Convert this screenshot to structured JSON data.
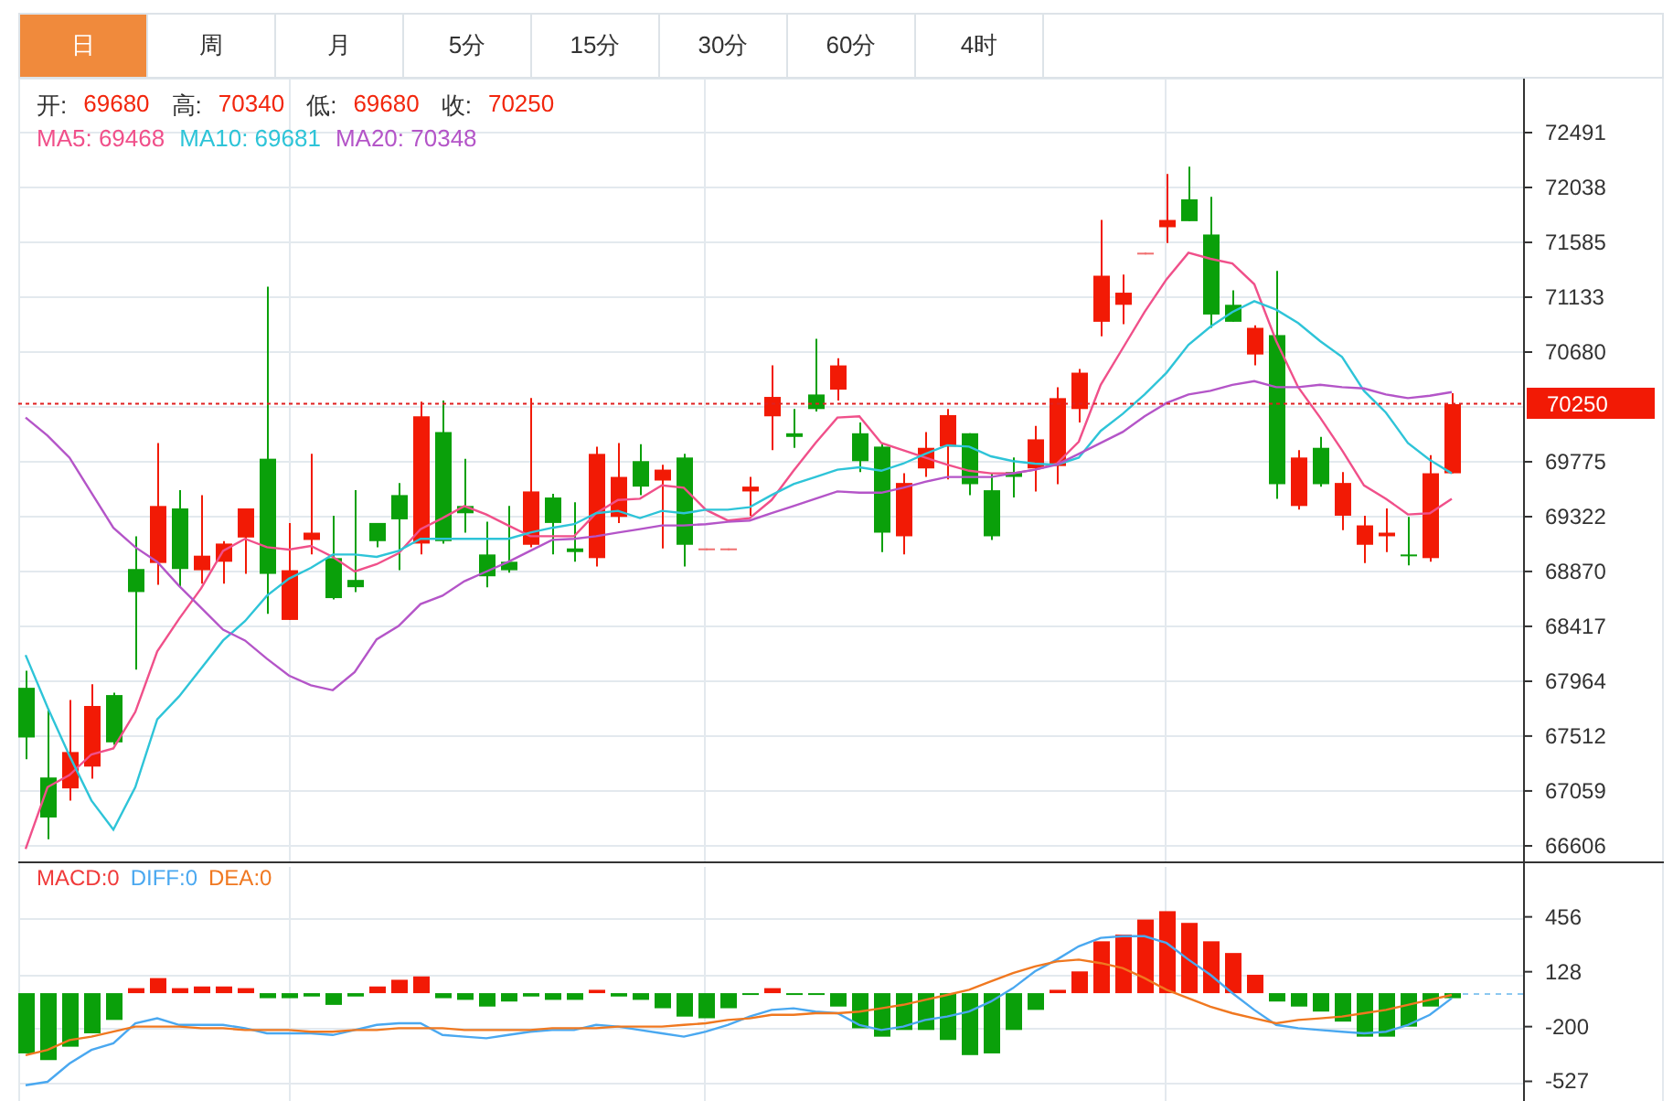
{
  "tabs": [
    {
      "label": "日",
      "selected": true
    },
    {
      "label": "周",
      "selected": false
    },
    {
      "label": "月",
      "selected": false
    },
    {
      "label": "5分",
      "selected": false
    },
    {
      "label": "15分",
      "selected": false
    },
    {
      "label": "30分",
      "selected": false
    },
    {
      "label": "60分",
      "selected": false
    },
    {
      "label": "4时",
      "selected": false
    }
  ],
  "price_chart": {
    "ohlc_legend": [
      {
        "label": "开:",
        "value": "69680"
      },
      {
        "label": "高:",
        "value": "70340"
      },
      {
        "label": "低:",
        "value": "69680"
      },
      {
        "label": "收:",
        "value": "70250"
      }
    ],
    "ma_legend": [
      {
        "text": "MA5: 69468",
        "color": "#f0508a"
      },
      {
        "text": "MA10: 69681",
        "color": "#2ec4d8"
      },
      {
        "text": "MA20: 70348",
        "color": "#b455c8"
      }
    ],
    "chart_data": {
      "type": "candlestick",
      "ylim": [
        66470,
        72936
      ],
      "yticks": [
        72491,
        72038,
        71585,
        71133,
        70680,
        69775,
        69322,
        68870,
        68417,
        67964,
        67512,
        67059,
        66606
      ],
      "ohlc": [
        [
          67910,
          68050,
          67320,
          67500
        ],
        [
          67170,
          67730,
          66660,
          66840
        ],
        [
          67080,
          67810,
          66980,
          67380
        ],
        [
          67260,
          67940,
          67160,
          67760
        ],
        [
          67850,
          67870,
          67440,
          67460
        ],
        [
          68890,
          69160,
          68060,
          68700
        ],
        [
          68940,
          69930,
          68760,
          69410
        ],
        [
          69390,
          69540,
          68740,
          68890
        ],
        [
          68880,
          69500,
          68770,
          69000
        ],
        [
          68950,
          69120,
          68770,
          69100
        ],
        [
          69150,
          69390,
          68850,
          69390
        ],
        [
          69800,
          71220,
          68520,
          68850
        ],
        [
          68470,
          69270,
          68470,
          68880
        ],
        [
          69130,
          69840,
          69010,
          69190
        ],
        [
          68980,
          69330,
          68640,
          68650
        ],
        [
          68800,
          69540,
          68700,
          68740
        ],
        [
          69270,
          69270,
          69070,
          69120
        ],
        [
          69500,
          69600,
          68880,
          69300
        ],
        [
          69100,
          70270,
          69010,
          70150
        ],
        [
          70020,
          70280,
          69100,
          69120
        ],
        [
          69410,
          69800,
          69190,
          69350
        ],
        [
          69010,
          69280,
          68740,
          68830
        ],
        [
          68950,
          69410,
          68860,
          68880
        ],
        [
          69090,
          70300,
          69070,
          69530
        ],
        [
          69480,
          69510,
          69010,
          69270
        ],
        [
          69060,
          69440,
          68950,
          69030
        ],
        [
          68980,
          69900,
          68910,
          69840
        ],
        [
          69320,
          69930,
          69270,
          69650
        ],
        [
          69780,
          69920,
          69500,
          69570
        ],
        [
          69620,
          69750,
          69060,
          69710
        ],
        [
          69810,
          69840,
          68910,
          69090
        ],
        [
          69060,
          69060,
          69060,
          69060
        ],
        [
          69060,
          69060,
          69060,
          69060
        ],
        [
          69530,
          69650,
          69330,
          69570
        ],
        [
          70150,
          70570,
          69870,
          70310
        ],
        [
          70010,
          70210,
          69890,
          69980
        ],
        [
          70330,
          70790,
          70190,
          70210
        ],
        [
          70370,
          70630,
          70280,
          70570
        ],
        [
          70010,
          70100,
          69690,
          69780
        ],
        [
          69900,
          69920,
          69030,
          69190
        ],
        [
          69160,
          69680,
          69010,
          69600
        ],
        [
          69720,
          70020,
          69650,
          69890
        ],
        [
          69900,
          70210,
          69630,
          70160
        ],
        [
          70010,
          70010,
          69500,
          69590
        ],
        [
          69540,
          69680,
          69130,
          69160
        ],
        [
          69690,
          69810,
          69480,
          69650
        ],
        [
          69720,
          70070,
          69530,
          69960
        ],
        [
          69740,
          70390,
          69590,
          70300
        ],
        [
          70210,
          70540,
          70100,
          70510
        ],
        [
          70930,
          71770,
          70810,
          71310
        ],
        [
          71070,
          71320,
          70910,
          71170
        ],
        [
          71500,
          71500,
          71500,
          71500
        ],
        [
          71710,
          72150,
          71580,
          71770
        ],
        [
          71940,
          72210,
          71760,
          71760
        ],
        [
          71650,
          71960,
          70880,
          70990
        ],
        [
          71070,
          71190,
          70930,
          70930
        ],
        [
          70660,
          70900,
          70570,
          70880
        ],
        [
          70820,
          71350,
          69470,
          69590
        ],
        [
          69410,
          69870,
          69380,
          69810
        ],
        [
          69890,
          69980,
          69570,
          69590
        ],
        [
          69330,
          69690,
          69210,
          69600
        ],
        [
          69090,
          69330,
          68940,
          69250
        ],
        [
          69160,
          69390,
          69030,
          69190
        ],
        [
          69010,
          69320,
          68920,
          69000
        ],
        [
          68980,
          69830,
          68950,
          69680
        ],
        [
          69680,
          70340,
          69680,
          70250
        ]
      ]
    },
    "last_price": "70250",
    "moving_averages": {
      "chart_data": {
        "type": "line",
        "ylim": [
          66470,
          72936
        ],
        "series": [
          {
            "color": "#f0508a",
            "values": [
              66580,
              67090,
              67190,
              67360,
              67410,
              67710,
              68210,
              68480,
              68730,
              69040,
              69140,
              69070,
              69050,
              69080,
              68990,
              68870,
              68930,
              69020,
              69220,
              69310,
              69410,
              69340,
              69250,
              69160,
              69160,
              69160,
              69350,
              69460,
              69470,
              69580,
              69560,
              69380,
              69290,
              69310,
              69460,
              69700,
              69930,
              70140,
              70150,
              69930,
              69870,
              69810,
              69750,
              69700,
              69680,
              69680,
              69710,
              69760,
              69940,
              70410,
              70710,
              71010,
              71280,
              71500,
              71450,
              71410,
              71240,
              70770,
              70390,
              70140,
              69870,
              69580,
              69470,
              69340,
              69350,
              69470
            ]
          },
          {
            "color": "#2ec4d8",
            "values": [
              68180,
              67750,
              67350,
              66980,
              66740,
              67090,
              67650,
              67840,
              68070,
              68300,
              68460,
              68670,
              68810,
              68900,
              69010,
              69010,
              68990,
              69040,
              69140,
              69140,
              69140,
              69140,
              69140,
              69190,
              69230,
              69260,
              69350,
              69370,
              69310,
              69370,
              69350,
              69380,
              69380,
              69400,
              69500,
              69590,
              69650,
              69710,
              69730,
              69700,
              69760,
              69840,
              69910,
              69900,
              69820,
              69780,
              69760,
              69750,
              69810,
              70030,
              70170,
              70330,
              70510,
              70740,
              70890,
              71010,
              71100,
              71030,
              70920,
              70770,
              70640,
              70360,
              70180,
              69930,
              69790,
              69680
            ]
          },
          {
            "color": "#b455c8",
            "values": [
              70140,
              69990,
              69810,
              69520,
              69230,
              69070,
              68950,
              68750,
              68570,
              68390,
              68300,
              68150,
              68010,
              67930,
              67890,
              68040,
              68310,
              68420,
              68600,
              68670,
              68790,
              68870,
              68950,
              69040,
              69130,
              69140,
              69160,
              69190,
              69220,
              69250,
              69250,
              69260,
              69280,
              69290,
              69350,
              69410,
              69470,
              69530,
              69520,
              69520,
              69560,
              69610,
              69650,
              69650,
              69650,
              69680,
              69710,
              69750,
              69840,
              69930,
              70020,
              70150,
              70260,
              70330,
              70360,
              70410,
              70440,
              70390,
              70390,
              70410,
              70390,
              70380,
              70330,
              70300,
              70320,
              70350
            ]
          }
        ]
      }
    }
  },
  "macd_chart": {
    "legend": [
      {
        "text": "MACD:0",
        "color": "#f03a3a"
      },
      {
        "text": "DIFF:0",
        "color": "#4aa8f0"
      },
      {
        "text": "DEA:0",
        "color": "#f07820"
      }
    ],
    "histogram": {
      "chart_data": {
        "type": "bar",
        "ylim": [
          -650,
          782
        ],
        "yticks": [
          456,
          128,
          -200,
          -527
        ],
        "series": [
          {
            "color": "#f21a05",
            "values": [
              null,
              null,
              null,
              null,
              null,
              30,
              90,
              30,
              40,
              40,
              30,
              null,
              null,
              null,
              null,
              null,
              40,
              80,
              100,
              null,
              null,
              null,
              null,
              null,
              null,
              null,
              20,
              null,
              null,
              null,
              null,
              null,
              null,
              null,
              30,
              null,
              null,
              null,
              null,
              null,
              null,
              null,
              null,
              null,
              null,
              null,
              null,
              20,
              130,
              310,
              350,
              440,
              490,
              420,
              310,
              240,
              110,
              null,
              null,
              null,
              null,
              null,
              null,
              null,
              null,
              null
            ]
          },
          {
            "color": "#0aa00a",
            "values": [
              -360,
              -400,
              -320,
              -240,
              -160,
              null,
              null,
              null,
              null,
              null,
              null,
              -30,
              -30,
              -20,
              -70,
              -20,
              null,
              null,
              null,
              -30,
              -40,
              -80,
              -50,
              -20,
              -40,
              -40,
              null,
              -20,
              -40,
              -90,
              -140,
              -150,
              -90,
              -10,
              null,
              -10,
              -10,
              -80,
              -210,
              -260,
              -220,
              -220,
              -280,
              -370,
              -360,
              -220,
              -100,
              null,
              null,
              null,
              null,
              null,
              null,
              null,
              null,
              null,
              null,
              -50,
              -80,
              -110,
              -170,
              -260,
              -260,
              -200,
              -80,
              -30
            ]
          }
        ]
      }
    },
    "lines": {
      "chart_data": {
        "type": "line",
        "ylim": [
          -650,
          782
        ],
        "series": [
          {
            "color": "#4aa8f0",
            "values": [
              -550,
              -530,
              -420,
              -340,
              -300,
              -180,
              -150,
              -190,
              -190,
              -190,
              -210,
              -240,
              -240,
              -240,
              -250,
              -220,
              -190,
              -180,
              -180,
              -250,
              -260,
              -270,
              -250,
              -230,
              -220,
              -220,
              -190,
              -200,
              -220,
              -240,
              -260,
              -230,
              -190,
              -140,
              -100,
              -90,
              -110,
              -120,
              -190,
              -220,
              -200,
              -160,
              -140,
              -110,
              -50,
              30,
              130,
              200,
              280,
              330,
              340,
              340,
              300,
              200,
              110,
              0,
              -100,
              -190,
              -210,
              -220,
              -230,
              -240,
              -230,
              -190,
              -130,
              -30
            ]
          },
          {
            "color": "#f07820",
            "values": [
              -370,
              -340,
              -280,
              -260,
              -230,
              -200,
              -200,
              -200,
              -210,
              -210,
              -220,
              -220,
              -220,
              -230,
              -230,
              -220,
              -220,
              -210,
              -210,
              -210,
              -220,
              -220,
              -220,
              -220,
              -210,
              -210,
              -210,
              -200,
              -200,
              -200,
              -190,
              -180,
              -160,
              -150,
              -130,
              -130,
              -120,
              -120,
              -110,
              -90,
              -70,
              -40,
              -10,
              20,
              70,
              120,
              160,
              190,
              200,
              180,
              150,
              90,
              20,
              -30,
              -80,
              -120,
              -150,
              -180,
              -160,
              -150,
              -140,
              -120,
              -100,
              -70,
              -40,
              -10
            ]
          }
        ]
      }
    }
  }
}
